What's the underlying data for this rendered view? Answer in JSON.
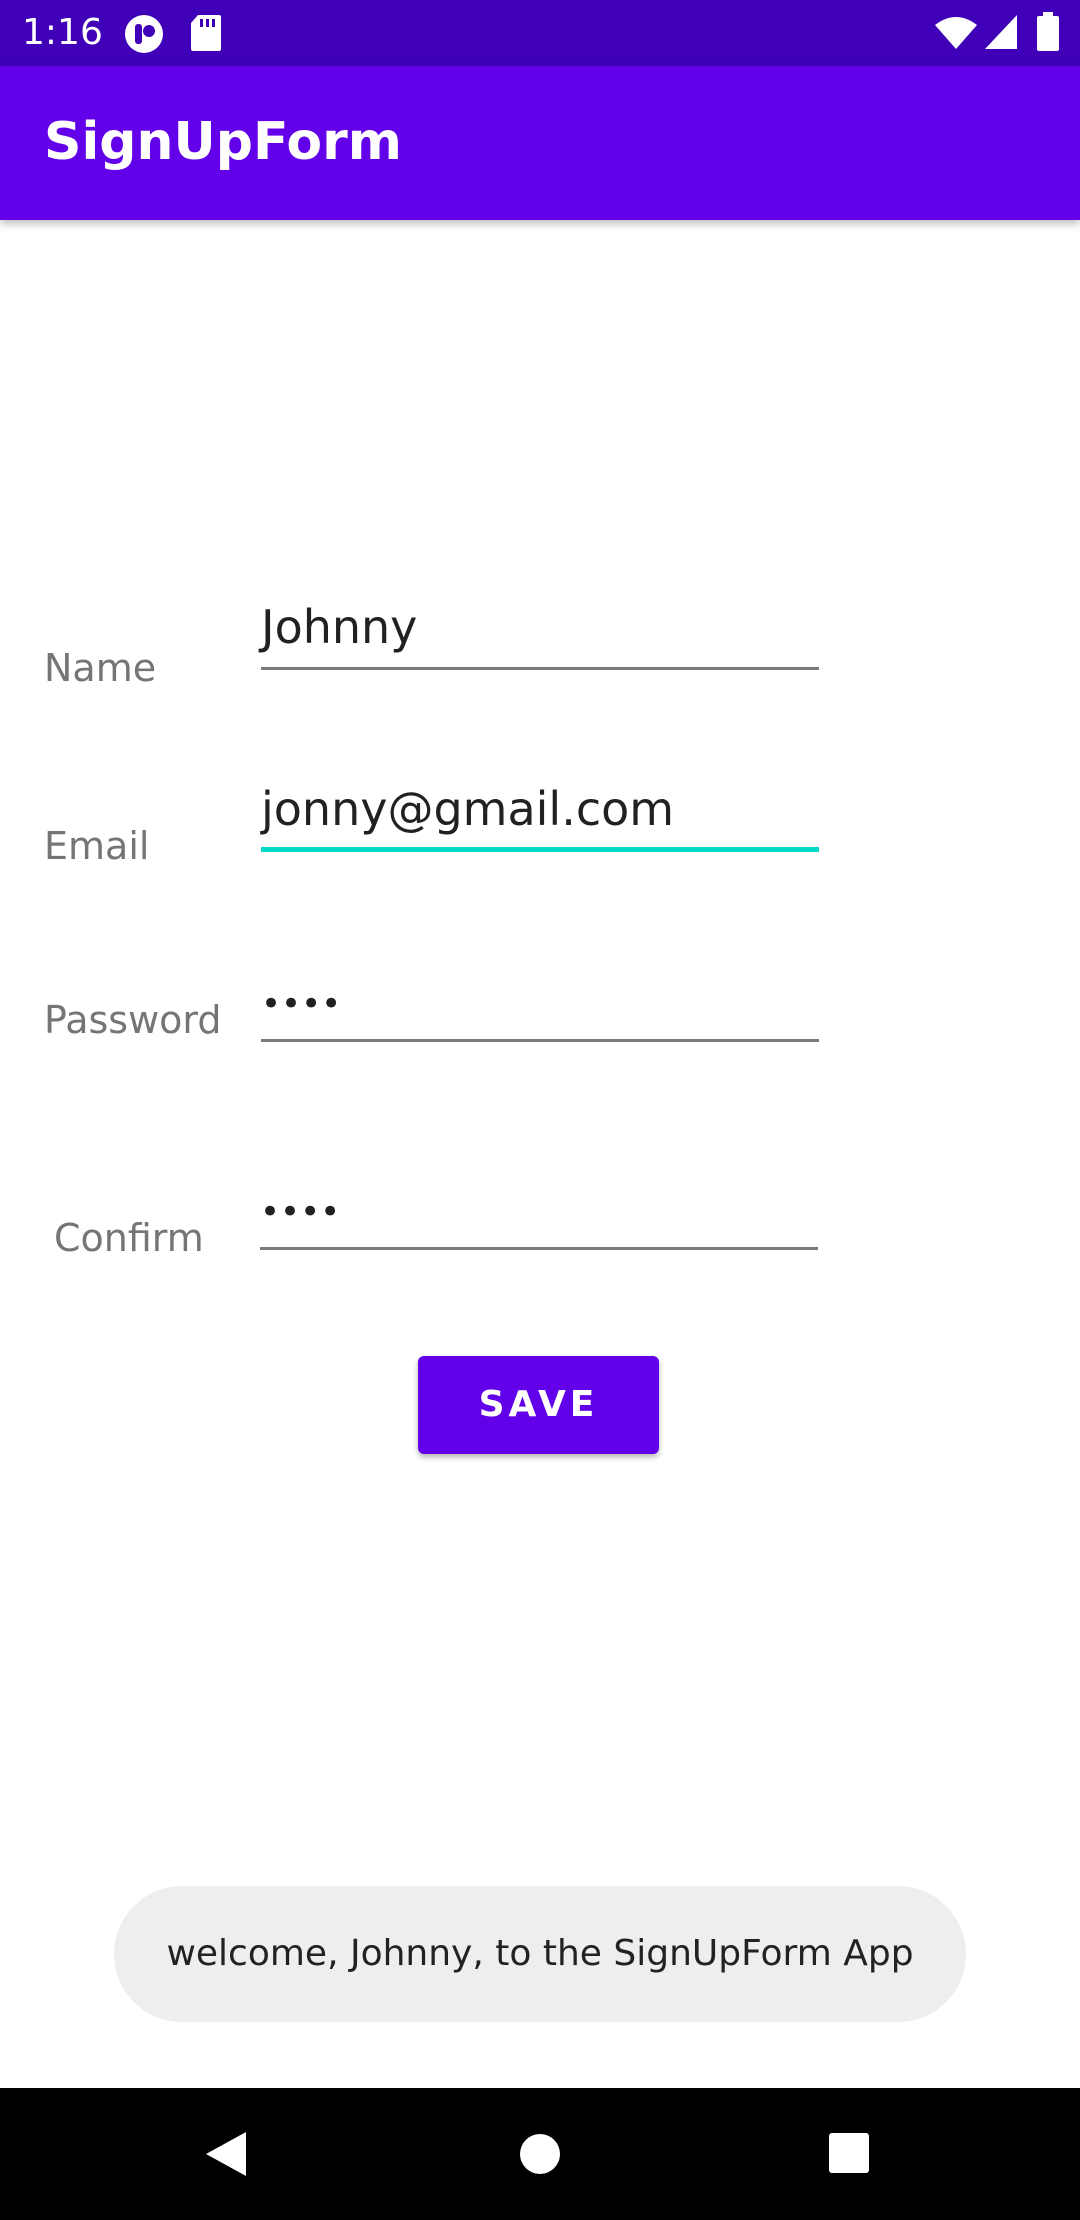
{
  "status_bar": {
    "time": "1:16",
    "left_icons": [
      "notification-app-icon",
      "sd-card-icon"
    ],
    "right_icons": [
      "wifi-icon",
      "cell-signal-icon",
      "battery-icon"
    ]
  },
  "app_bar": {
    "title": "SignUpForm",
    "color": "#6200ea"
  },
  "form": {
    "name": {
      "label": "Name",
      "value": "Johnny"
    },
    "email": {
      "label": "Email",
      "value": "jonny@gmail.com",
      "focused": true
    },
    "password": {
      "label": "Password",
      "masked_value": "••••"
    },
    "confirm": {
      "label": "Confirm",
      "masked_value": "••••"
    },
    "focus_color": "#03dac5"
  },
  "save_button": {
    "label": "SAVE"
  },
  "toast": {
    "message": "welcome, Johnny, to the SignUpForm App"
  },
  "nav_bar": {
    "icons": [
      "back-icon",
      "home-icon",
      "recents-icon"
    ]
  }
}
